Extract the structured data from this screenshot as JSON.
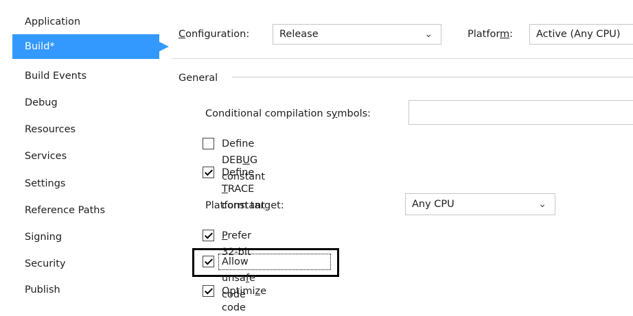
{
  "sidebar": {
    "items": [
      {
        "label": "Application",
        "selected": false
      },
      {
        "label": "Build*",
        "selected": true
      },
      {
        "label": "Build Events",
        "selected": false
      },
      {
        "label": "Debug",
        "selected": false
      },
      {
        "label": "Resources",
        "selected": false
      },
      {
        "label": "Services",
        "selected": false
      },
      {
        "label": "Settings",
        "selected": false
      },
      {
        "label": "Reference Paths",
        "selected": false
      },
      {
        "label": "Signing",
        "selected": false
      },
      {
        "label": "Security",
        "selected": false
      },
      {
        "label": "Publish",
        "selected": false
      }
    ]
  },
  "header": {
    "configuration_label_pre": "",
    "configuration_label_u": "C",
    "configuration_label_post": "onfiguration:",
    "configuration_value": "Release",
    "platform_label_pre": "Platfor",
    "platform_label_u": "m",
    "platform_label_post": ":",
    "platform_value": "Active (Any CPU)"
  },
  "general": {
    "group_label": "General",
    "conditional_symbols_label_pre": "Conditional compilation s",
    "conditional_symbols_label_u": "y",
    "conditional_symbols_label_post": "mbols:",
    "conditional_symbols_value": "",
    "define_debug": {
      "pre": "Define DEB",
      "u": "U",
      "post": "G constant",
      "checked": false
    },
    "define_trace": {
      "pre": "Define ",
      "u": "T",
      "post": "RACE constant",
      "checked": true
    },
    "platform_target_label_pre": "Platform tar",
    "platform_target_label_u": "g",
    "platform_target_label_post": "et:",
    "platform_target_value": "Any CPU",
    "prefer_32bit": {
      "pre": "",
      "u": "P",
      "post": "refer 32-bit",
      "checked": true
    },
    "allow_unsafe": {
      "pre": "Allow unsa",
      "u": "f",
      "post": "e code",
      "checked": true
    },
    "optimize": {
      "pre": "Optimi",
      "u": "z",
      "post": "e code",
      "checked": true
    }
  },
  "icons": {
    "dropdown": "chevron-down-icon",
    "checkbox": "checkmark-icon"
  },
  "colors": {
    "accent": "#3399ff",
    "highlight_border": "#000000"
  }
}
